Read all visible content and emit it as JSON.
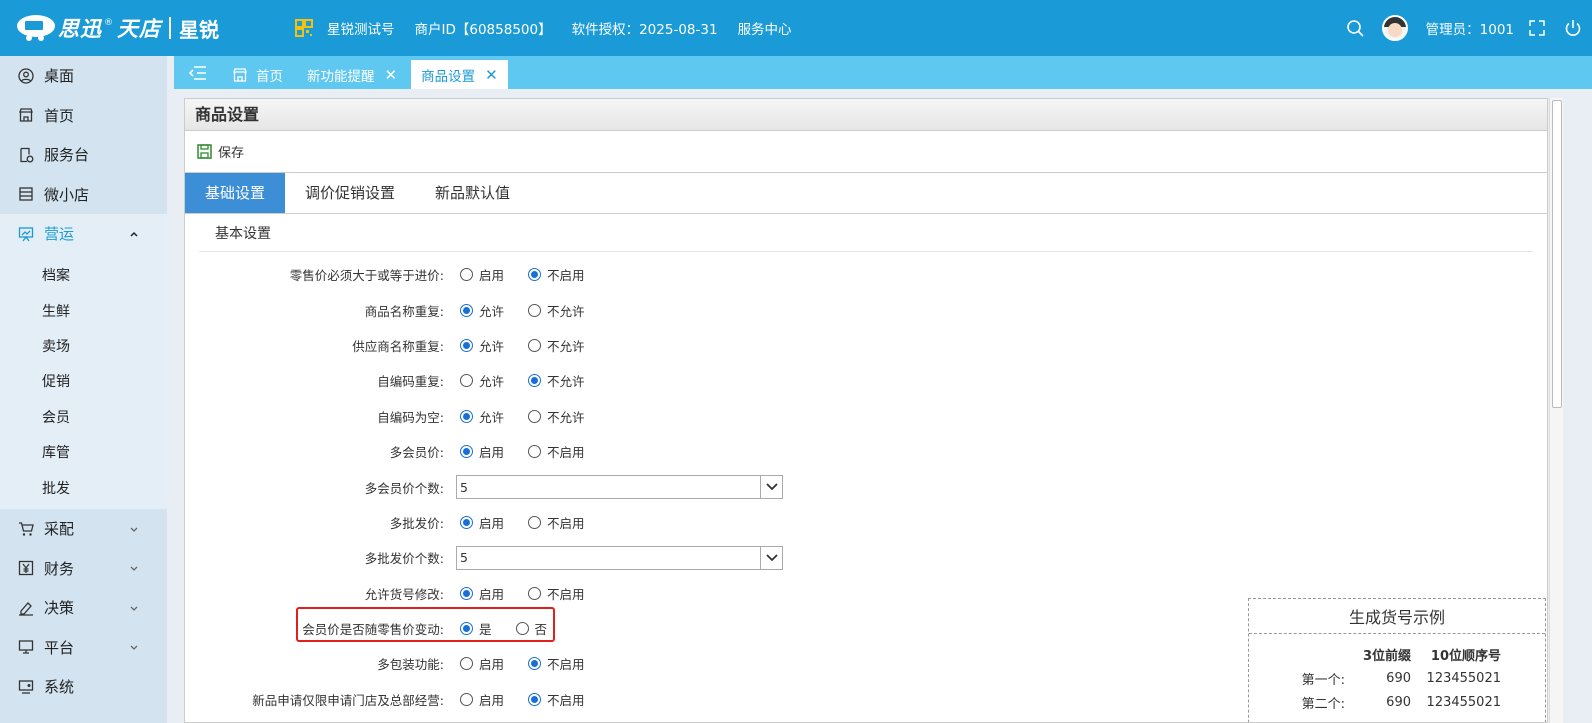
{
  "topbar": {
    "brand": "思迅",
    "brand_sub": "天店",
    "product": "星锐",
    "items": [
      "星锐测试号",
      "商户ID【60858500】",
      "软件授权：2025-08-31",
      "服务中心"
    ],
    "admin": "管理员：1001"
  },
  "sidebar": {
    "items": [
      {
        "label": "桌面",
        "icon": "user-circle-icon"
      },
      {
        "label": "首页",
        "icon": "store-icon"
      },
      {
        "label": "服务台",
        "icon": "service-doc-icon"
      },
      {
        "label": "微小店",
        "icon": "shop-icon"
      },
      {
        "label": "营运",
        "icon": "chart-board-icon"
      },
      {
        "label": "采配",
        "icon": "cart-icon"
      },
      {
        "label": "财务",
        "icon": "yen-icon"
      },
      {
        "label": "决策",
        "icon": "pen-icon"
      },
      {
        "label": "平台",
        "icon": "monitor-icon"
      },
      {
        "label": "系统",
        "icon": "system-icon"
      }
    ],
    "submenu": [
      "档案",
      "生鲜",
      "卖场",
      "促销",
      "会员",
      "库管",
      "批发"
    ]
  },
  "tabs": [
    {
      "label": "首页"
    },
    {
      "label": "新功能提醒"
    },
    {
      "label": "商品设置"
    }
  ],
  "panel": {
    "title": "商品设置",
    "save_label": "保存",
    "content_tabs": [
      "基础设置",
      "调价促销设置",
      "新品默认值"
    ],
    "section_title": "基本设置"
  },
  "form": {
    "rows": [
      {
        "label": "零售价必须大于或等于进价:",
        "opt1": "启用",
        "opt2": "不启用",
        "selected": 2
      },
      {
        "label": "商品名称重复:",
        "opt1": "允许",
        "opt2": "不允许",
        "selected": 1
      },
      {
        "label": "供应商名称重复:",
        "opt1": "允许",
        "opt2": "不允许",
        "selected": 1
      },
      {
        "label": "自编码重复:",
        "opt1": "允许",
        "opt2": "不允许",
        "selected": 2
      },
      {
        "label": "自编码为空:",
        "opt1": "允许",
        "opt2": "不允许",
        "selected": 1
      },
      {
        "label": "多会员价:",
        "opt1": "启用",
        "opt2": "不启用",
        "selected": 1
      },
      {
        "label": "多会员价个数:",
        "select_value": "5"
      },
      {
        "label": "多批发价:",
        "opt1": "启用",
        "opt2": "不启用",
        "selected": 1
      },
      {
        "label": "多批发价个数:",
        "select_value": "5"
      },
      {
        "label": "允许货号修改:",
        "opt1": "启用",
        "opt2": "不启用",
        "selected": 1
      },
      {
        "label": "会员价是否随零售价变动:",
        "opt1": "是",
        "opt2": "否",
        "selected": 1
      },
      {
        "label": "多包装功能:",
        "opt1": "启用",
        "opt2": "不启用",
        "selected": 2
      },
      {
        "label": "新品申请仅限申请门店及总部经营:",
        "opt1": "启用",
        "opt2": "不启用",
        "selected": 2
      }
    ]
  },
  "example": {
    "title": "生成货号示例",
    "headers": [
      "3位前缀",
      "10位顺序号"
    ],
    "rows": [
      {
        "name": "第一个:",
        "prefix": "690",
        "seq": "123455021"
      },
      {
        "name": "第二个:",
        "prefix": "690",
        "seq": "123455021"
      }
    ]
  },
  "colors": {
    "topbar": "#1a9bd7",
    "tabbar": "#5ec8f0",
    "active_tab": "#3c8fd6",
    "highlight": "#e0201b"
  }
}
